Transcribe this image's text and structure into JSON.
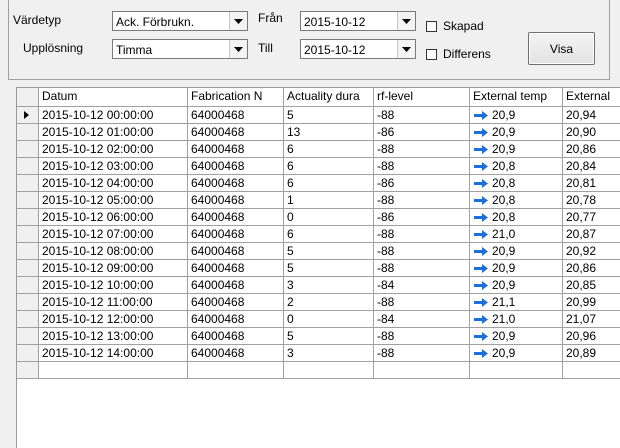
{
  "filters": {
    "vardetyp_label": "Värdetyp",
    "vardetyp_value": "Ack. Förbrukn.",
    "upplosning_label": "Upplösning",
    "upplosning_value": "Timma",
    "fran_label": "Från",
    "fran_value": "2015-10-12",
    "till_label": "Till",
    "till_value": "2015-10-12",
    "skapad_label": "Skapad",
    "differens_label": "Differens",
    "visa_label": "Visa"
  },
  "table": {
    "columns": [
      "Datum",
      "Fabrication N",
      "Actuality dura",
      "rf-level",
      "External temp",
      "External"
    ],
    "trend_icon": "arrow-right-icon",
    "trend_color": "#1e6fd9",
    "rows": [
      [
        "2015-10-12 00:00:00",
        "64000468",
        "5",
        "-88",
        "20,9",
        "20,94"
      ],
      [
        "2015-10-12 01:00:00",
        "64000468",
        "13",
        "-86",
        "20,9",
        "20,90"
      ],
      [
        "2015-10-12 02:00:00",
        "64000468",
        "6",
        "-88",
        "20,9",
        "20,86"
      ],
      [
        "2015-10-12 03:00:00",
        "64000468",
        "6",
        "-88",
        "20,8",
        "20,84"
      ],
      [
        "2015-10-12 04:00:00",
        "64000468",
        "6",
        "-86",
        "20,8",
        "20,81"
      ],
      [
        "2015-10-12 05:00:00",
        "64000468",
        "1",
        "-88",
        "20,8",
        "20,78"
      ],
      [
        "2015-10-12 06:00:00",
        "64000468",
        "0",
        "-86",
        "20,8",
        "20,77"
      ],
      [
        "2015-10-12 07:00:00",
        "64000468",
        "6",
        "-88",
        "21,0",
        "20,87"
      ],
      [
        "2015-10-12 08:00:00",
        "64000468",
        "5",
        "-88",
        "20,9",
        "20,92"
      ],
      [
        "2015-10-12 09:00:00",
        "64000468",
        "5",
        "-88",
        "20,9",
        "20,86"
      ],
      [
        "2015-10-12 10:00:00",
        "64000468",
        "3",
        "-84",
        "20,9",
        "20,85"
      ],
      [
        "2015-10-12 11:00:00",
        "64000468",
        "2",
        "-88",
        "21,1",
        "20,99"
      ],
      [
        "2015-10-12 12:00:00",
        "64000468",
        "0",
        "-84",
        "21,0",
        "21,07"
      ],
      [
        "2015-10-12 13:00:00",
        "64000468",
        "5",
        "-88",
        "20,9",
        "20,96"
      ],
      [
        "2015-10-12 14:00:00",
        "64000468",
        "3",
        "-88",
        "20,9",
        "20,89"
      ]
    ]
  }
}
